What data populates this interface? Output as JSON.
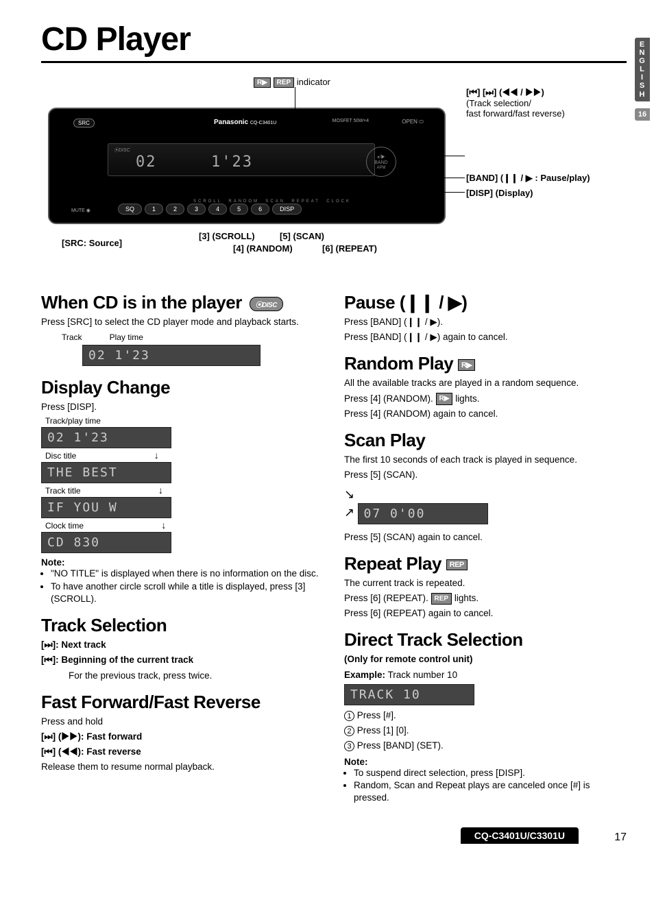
{
  "page": {
    "title": "CD Player",
    "side_tab": "E\nN\nG\nL\nI\nS\nH",
    "side_page": "16",
    "footer_model": "CQ-C3401U/C3301U",
    "footer_page": "17"
  },
  "diagram": {
    "rep_indicator_label": "indicator",
    "rep_badge_r": "R▶",
    "rep_badge_rep": "REP",
    "top_right_line1": "[⏮] [⏭] (◀◀ / ▶▶)",
    "top_right_line2": "(Track selection/",
    "top_right_line3": "fast forward/fast reverse)",
    "band_label": "[BAND] (❙❙ / ▶ : Pause/play)",
    "disp_label": "[DISP] (Display)",
    "src_label": "[SRC: Source]",
    "btn3": "[3] (SCROLL)",
    "btn4": "[4] (RANDOM)",
    "btn5": "[5] (SCAN)",
    "btn6": "[6] (REPEAT)",
    "lcd_track": "02",
    "lcd_time": "1'23",
    "brand": "Panasonic",
    "model_small": "CQ-C3401U",
    "mosfet": "MOSFET 50W×4",
    "preset_buttons": [
      "1",
      "2",
      "3",
      "4",
      "5",
      "6"
    ],
    "sq": "SQ",
    "mute": "MUTE",
    "disp_btn": "DISP",
    "src_btn": "SRC",
    "open": "OPEN",
    "mini_labels": [
      "SCROLL",
      "RANDOM",
      "SCAN",
      "REPEAT",
      "CLOCK"
    ]
  },
  "left": {
    "when_cd_head": "When CD is in the player",
    "when_cd_body": "Press [SRC] to select the CD player mode and playback starts.",
    "track_label": "Track",
    "playtime_label": "Play time",
    "lcd1": "02   1'23",
    "disp_change_head": "Display Change",
    "disp_change_body": "Press [DISP].",
    "seq_label1": "Track/play time",
    "seq_lcd1": "02    1'23",
    "seq_label2": "Disc title",
    "seq_lcd2": "THE   BEST",
    "seq_label3": "Track title",
    "seq_lcd3": "IF  YOU  W",
    "seq_label4": "Clock time",
    "seq_lcd4": "CD     830",
    "note_head": "Note:",
    "note1": "\"NO TITLE\" is displayed when there is no information on the disc.",
    "note2": "To have another circle scroll while a title is displayed, press [3] (SCROLL).",
    "track_sel_head": "Track Selection",
    "track_sel_l1": "[⏭]: Next track",
    "track_sel_l2": "[⏮]: Beginning of the current track",
    "track_sel_l3": "        For the previous track, press twice.",
    "ff_head": "Fast Forward/Fast Reverse",
    "ff_l1": "Press and hold",
    "ff_l2": "[⏭] (▶▶): Fast forward",
    "ff_l3": "[⏮] (◀◀): Fast reverse",
    "ff_l4": "Release them to resume normal playback."
  },
  "right": {
    "pause_head": "Pause (❙❙ / ▶)",
    "pause_l1": "Press [BAND] (❙❙ / ▶).",
    "pause_l2": "Press [BAND] (❙❙ / ▶) again to cancel.",
    "random_head": "Random Play",
    "random_l1": "All the available tracks are played in a random sequence.",
    "random_l2a": "Press [4] (RANDOM). ",
    "random_l2b": " lights.",
    "random_l3": "Press [4] (RANDOM) again to cancel.",
    "scan_head": "Scan Play",
    "scan_l1": "The first 10 seconds of each track is played in sequence.",
    "scan_l2": "Press [5] (SCAN).",
    "scan_lcd": "07  0'00",
    "scan_l3": "Press [5] (SCAN) again to cancel.",
    "repeat_head": "Repeat Play",
    "repeat_l1": "The current track is repeated.",
    "repeat_l2a": "Press [6] (REPEAT). ",
    "repeat_l2b": " lights.",
    "repeat_l3": "Press [6] (REPEAT) again to cancel.",
    "direct_head": "Direct Track Selection",
    "direct_sub": "(Only for remote control unit)",
    "direct_ex_pre": "Example:",
    "direct_ex": " Track number 10",
    "direct_lcd": "TRACK   10",
    "direct_s1": "Press [#].",
    "direct_s2": "Press [1] [0].",
    "direct_s3": "Press [BAND] (SET).",
    "direct_note_head": "Note:",
    "direct_note1": "To suspend direct selection, press [DISP].",
    "direct_note2": "Random, Scan and Repeat plays are canceled once [#] is pressed."
  }
}
